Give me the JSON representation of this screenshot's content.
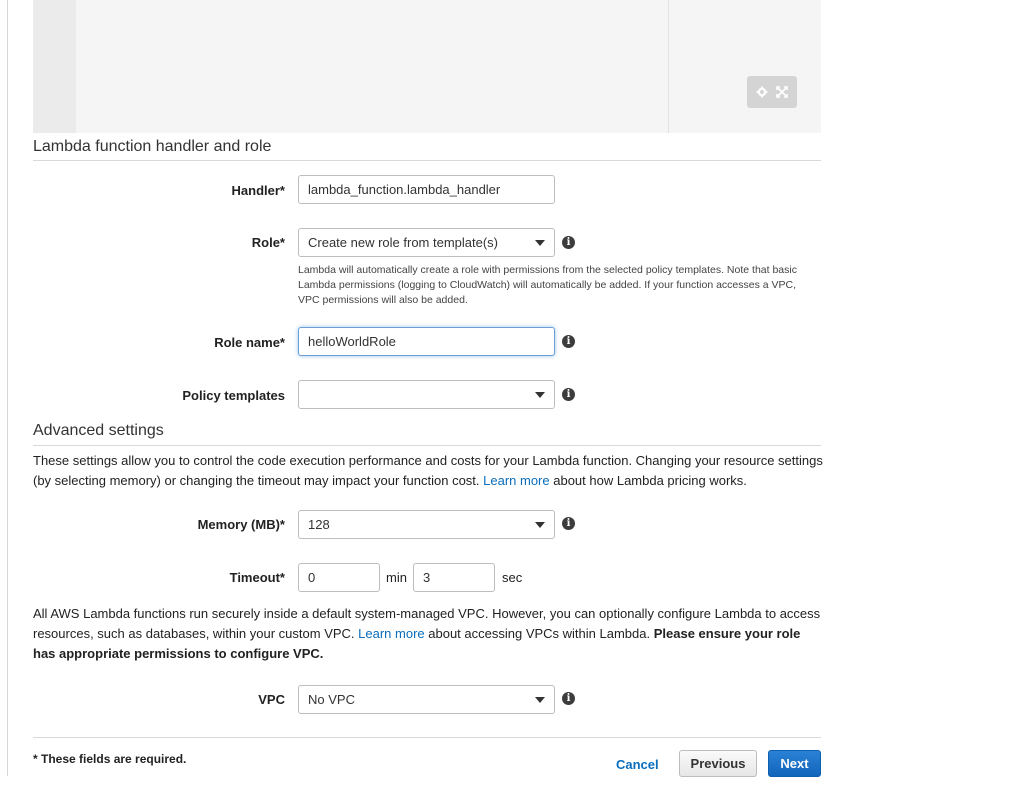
{
  "editor": {
    "settings_icon": "gear-icon",
    "fullscreen_icon": "expand-icon"
  },
  "handler_role": {
    "title": "Lambda function handler and role",
    "handler": {
      "label": "Handler*",
      "value": "lambda_function.lambda_handler"
    },
    "role": {
      "label": "Role*",
      "value": "Create new role from template(s)",
      "help": "Lambda will automatically create a role with permissions from the selected policy templates. Note that basic Lambda permissions (logging to CloudWatch) will automatically be added. If your function accesses a VPC, VPC permissions will also be added."
    },
    "role_name": {
      "label": "Role name*",
      "value": "helloWorldRole"
    },
    "policy_templates": {
      "label": "Policy templates",
      "value": ""
    }
  },
  "advanced": {
    "title": "Advanced settings",
    "description_before": "These settings allow you to control the code execution performance and costs for your Lambda function. Changing your resource settings (by selecting memory) or changing the timeout may impact your function cost. ",
    "learn_more": "Learn more",
    "description_after": " about how Lambda pricing works.",
    "memory": {
      "label": "Memory (MB)*",
      "value": "128"
    },
    "timeout": {
      "label": "Timeout*",
      "min_value": "0",
      "min_unit": "min",
      "sec_value": "3",
      "sec_unit": "sec"
    },
    "vpc_note_before": "All AWS Lambda functions run securely inside a default system-managed VPC. However, you can optionally configure Lambda to access resources, such as databases, within your custom VPC. ",
    "vpc_learn_more": "Learn more",
    "vpc_note_middle": " about accessing VPCs within Lambda. ",
    "vpc_note_bold": "Please ensure your role has appropriate permissions to configure VPC.",
    "vpc": {
      "label": "VPC",
      "value": "No VPC"
    }
  },
  "footer": {
    "required_note": "* These fields are required.",
    "cancel": "Cancel",
    "previous": "Previous",
    "next": "Next"
  },
  "info_icon_glyph": "i",
  "colors": {
    "link": "#0a6ebd",
    "primary_button": "#1a72c8"
  }
}
